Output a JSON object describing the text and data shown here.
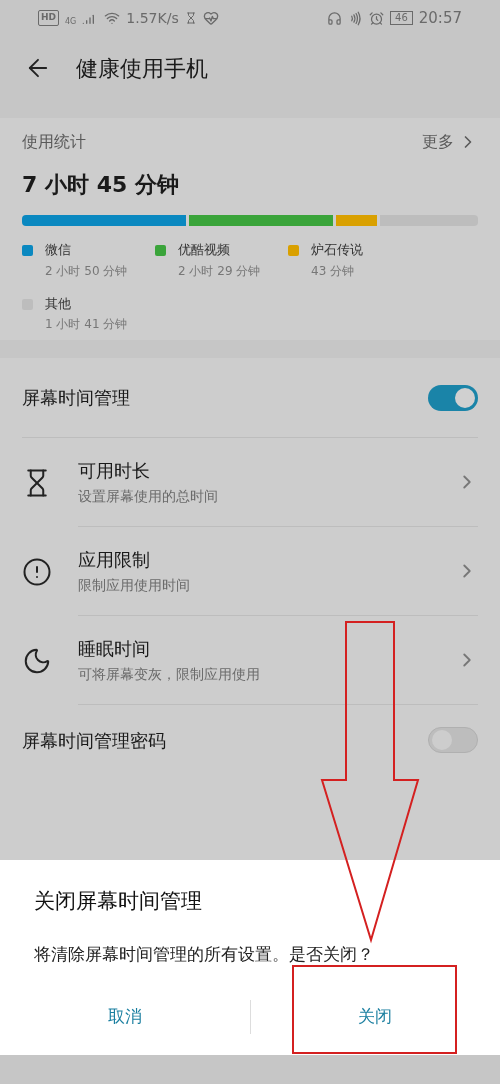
{
  "status_bar": {
    "hd": "HD",
    "network": "4G",
    "speed": "1.57K/s",
    "battery": "46",
    "time": "20:57"
  },
  "header": {
    "title": "健康使用手机"
  },
  "usage": {
    "title": "使用统计",
    "more": "更多",
    "total": "7 小时 45 分钟",
    "apps": [
      {
        "name": "微信",
        "time": "2 小时 50 分钟",
        "color": "#0a88c0"
      },
      {
        "name": "优酷视频",
        "time": "2 小时 29 分钟",
        "color": "#3aa43a"
      },
      {
        "name": "炉石传说",
        "time": "43 分钟",
        "color": "#d9a000"
      },
      {
        "name": "其他",
        "time": "1 小时 41 分钟",
        "color": "#bdbdbd"
      }
    ]
  },
  "settings": [
    {
      "kind": "toggle",
      "label": "屏幕时间管理",
      "on": true
    },
    {
      "kind": "link",
      "label": "可用时长",
      "sub": "设置屏幕使用的总时间"
    },
    {
      "kind": "link",
      "label": "应用限制",
      "sub": "限制应用使用时间"
    },
    {
      "kind": "link",
      "label": "睡眠时间",
      "sub": "可将屏幕变灰，限制应用使用"
    },
    {
      "kind": "toggle",
      "label": "屏幕时间管理密码",
      "on": false
    }
  ],
  "dialog": {
    "title": "关闭屏幕时间管理",
    "message": "将清除屏幕时间管理的所有设置。是否关闭？",
    "buttons": [
      "取消",
      "关闭"
    ]
  }
}
